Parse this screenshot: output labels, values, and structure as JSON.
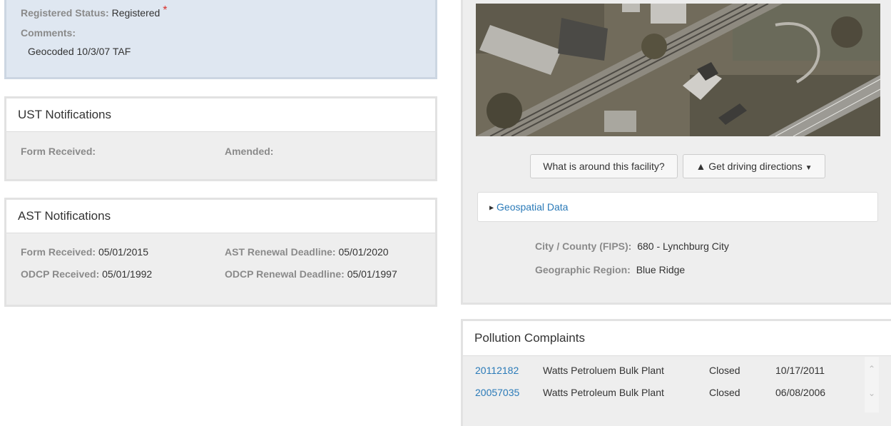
{
  "facility": {
    "registered_status_label": "Registered Status:",
    "registered_status_value": "Registered",
    "required_mark": "*",
    "comments_label": "Comments:",
    "comments_value": "Geocoded 10/3/07 TAF"
  },
  "ust": {
    "title": "UST Notifications",
    "form_received_label": "Form Received:",
    "amended_label": "Amended:"
  },
  "ast": {
    "title": "AST Notifications",
    "form_received_label": "Form Received:",
    "form_received_value": "05/01/2015",
    "renewal_label": "AST Renewal Deadline:",
    "renewal_value": "05/01/2020",
    "odcp_received_label": "ODCP Received:",
    "odcp_received_value": "05/01/1992",
    "odcp_renewal_label": "ODCP Renewal Deadline:",
    "odcp_renewal_value": "05/01/1997"
  },
  "map": {
    "around_button": "What is around this facility?",
    "directions_button": "Get driving directions",
    "geospatial_toggle": "Geospatial Data",
    "fips_label": "City / County (FIPS):",
    "fips_value": "680 - Lynchburg City",
    "region_label": "Geographic Region:",
    "region_value": "Blue Ridge"
  },
  "complaints": {
    "title": "Pollution Complaints",
    "rows": [
      {
        "id": "20112182",
        "name": "Watts Petroluem Bulk Plant",
        "status": "Closed",
        "date": "10/17/2011"
      },
      {
        "id": "20057035",
        "name": "Watts Petroleum Bulk Plant",
        "status": "Closed",
        "date": "06/08/2006"
      }
    ]
  }
}
